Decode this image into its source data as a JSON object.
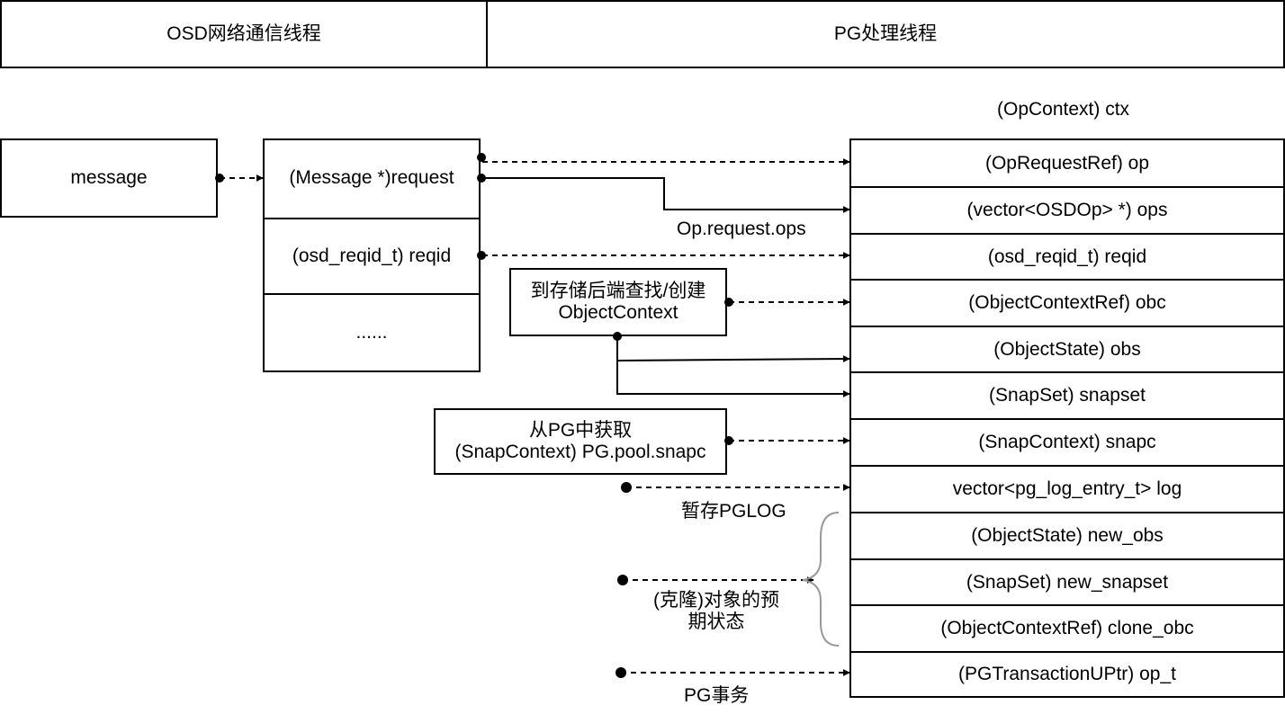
{
  "header": {
    "left_title": "OSD网络通信线程",
    "right_title": "PG处理线程"
  },
  "message_box": {
    "label": "message"
  },
  "request_struct": {
    "fields": [
      "(Message *)request",
      "(osd_reqid_t) reqid",
      "......"
    ]
  },
  "ctx_title": "(OpContext) ctx",
  "ctx_fields": [
    "(OpRequestRef) op",
    "(vector<OSDOp> *) ops",
    "(osd_reqid_t) reqid",
    "(ObjectContextRef) obc",
    "(ObjectState) obs",
    "(SnapSet) snapset",
    "(SnapContext) snapc",
    "vector<pg_log_entry_t> log",
    "(ObjectState) new_obs",
    "(SnapSet) new_snapset",
    "(ObjectContextRef) clone_obc",
    "(PGTransactionUPtr) op_t"
  ],
  "annotations": {
    "ops_label": "Op.request.ops",
    "obc_box_line1": "到存储后端查找/创建",
    "obc_box_line2": "ObjectContext",
    "snapc_box_line1": "从PG中获取",
    "snapc_box_line2": "(SnapContext) PG.pool.snapc",
    "pglog_label": "暂存PGLOG",
    "clone_label_line1": "(克隆)对象的预",
    "clone_label_line2": "期状态",
    "pg_txn_label": "PG事务"
  }
}
